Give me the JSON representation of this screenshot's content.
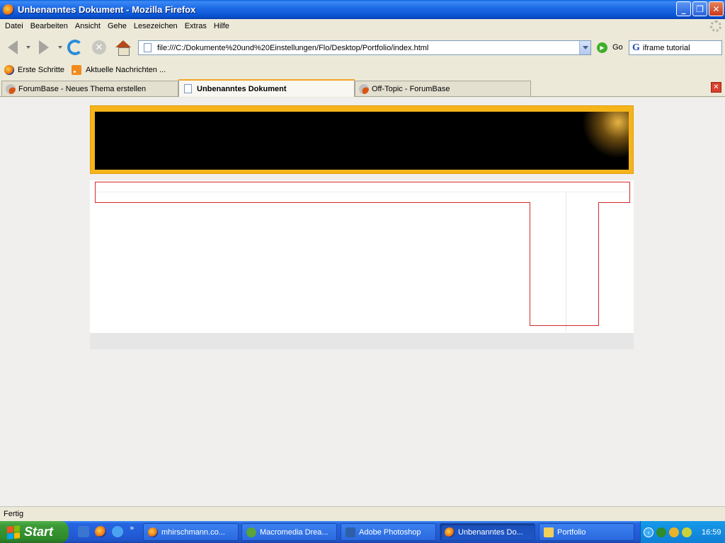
{
  "window": {
    "title": "Unbenanntes Dokument - Mozilla Firefox",
    "buttons": {
      "minimize": "_",
      "maximize": "❐",
      "close": "✕"
    }
  },
  "menu": [
    "Datei",
    "Bearbeiten",
    "Ansicht",
    "Gehe",
    "Lesezeichen",
    "Extras",
    "Hilfe"
  ],
  "navbar": {
    "url": "file:///C:/Dokumente%20und%20Einstellungen/Flo/Desktop/Portfolio/index.html",
    "go_label": "Go",
    "search_value": "iframe tutorial",
    "search_engine_icon": "G"
  },
  "bookmarks": [
    {
      "label": "Erste Schritte",
      "icon": "firefox-icon"
    },
    {
      "label": "Aktuelle Nachrichten ...",
      "icon": "rss-icon"
    }
  ],
  "tabs": [
    {
      "label": "ForumBase - Neues Thema erstellen",
      "active": false
    },
    {
      "label": "Unbenanntes Dokument",
      "active": true
    },
    {
      "label": "Off-Topic - ForumBase",
      "active": false
    }
  ],
  "status": {
    "text": "Fertig"
  },
  "taskbar": {
    "start_label": "Start",
    "tasks": [
      {
        "label": "mhirschmann.co...",
        "active": false
      },
      {
        "label": "Macromedia Drea...",
        "active": false
      },
      {
        "label": "Adobe Photoshop",
        "active": false
      },
      {
        "label": "Unbenanntes Do...",
        "active": true
      },
      {
        "label": "Portfolio",
        "active": false
      }
    ],
    "clock": "16:59"
  },
  "colors": {
    "header_border": "#f5b41a",
    "header_fill": "#000000",
    "outline": "#d12a2a"
  }
}
